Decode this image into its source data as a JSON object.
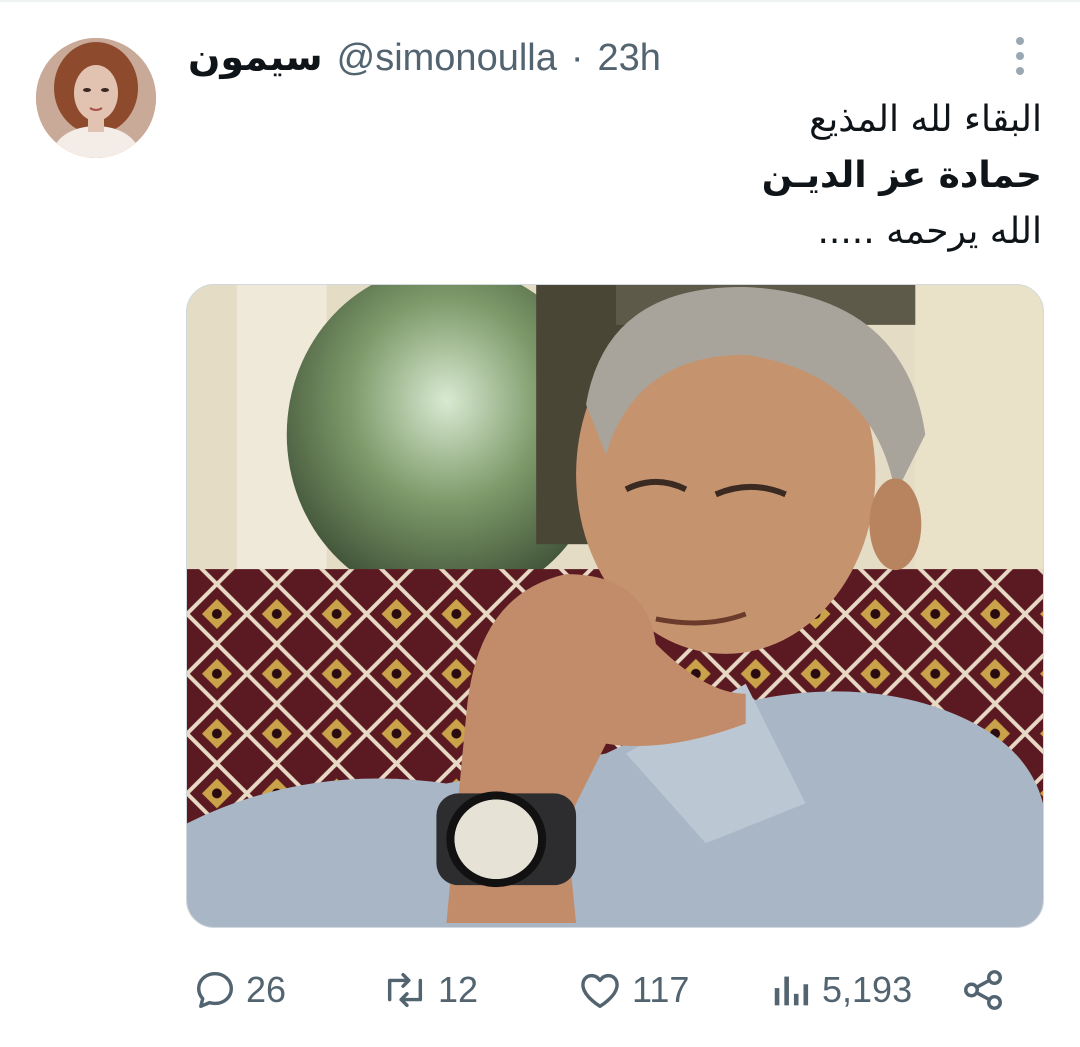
{
  "tweet": {
    "author": {
      "display_name": "سيمون",
      "handle": "@simonoulla",
      "separator": "·",
      "time": "23h"
    },
    "text_lines": [
      "البقاء لله  المذيع",
      "حمادة عز الديـن",
      "الله يرحمه ....."
    ],
    "media": {
      "alt": ""
    },
    "actions": {
      "replies": "26",
      "retweets": "12",
      "likes": "117",
      "views": "5,193"
    }
  },
  "icons": {
    "more": "more-vertical-icon",
    "reply": "reply-icon",
    "retweet": "retweet-icon",
    "like": "heart-icon",
    "views": "views-icon",
    "share": "share-icon"
  },
  "colors": {
    "text": "#0f1419",
    "secondary": "#536471",
    "border": "#cfd9de"
  }
}
